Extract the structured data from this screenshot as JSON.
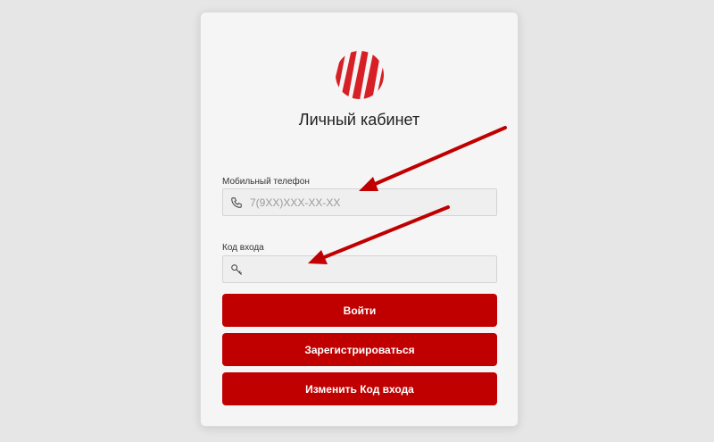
{
  "login": {
    "title": "Личный кабинет",
    "phone": {
      "label": "Мобильный телефон",
      "placeholder": "7(9XX)XXX-XX-XX",
      "value": ""
    },
    "code": {
      "label": "Код входа",
      "placeholder": "",
      "value": ""
    },
    "buttons": {
      "login": "Войти",
      "register": "Зарегистрироваться",
      "change_code": "Изменить Код входа"
    }
  },
  "colors": {
    "brand": "#c00000",
    "background": "#e6e6e6",
    "card": "#f5f5f5"
  },
  "icons": {
    "logo": "brand-logo-icon",
    "phone": "phone-icon",
    "key": "key-icon"
  }
}
